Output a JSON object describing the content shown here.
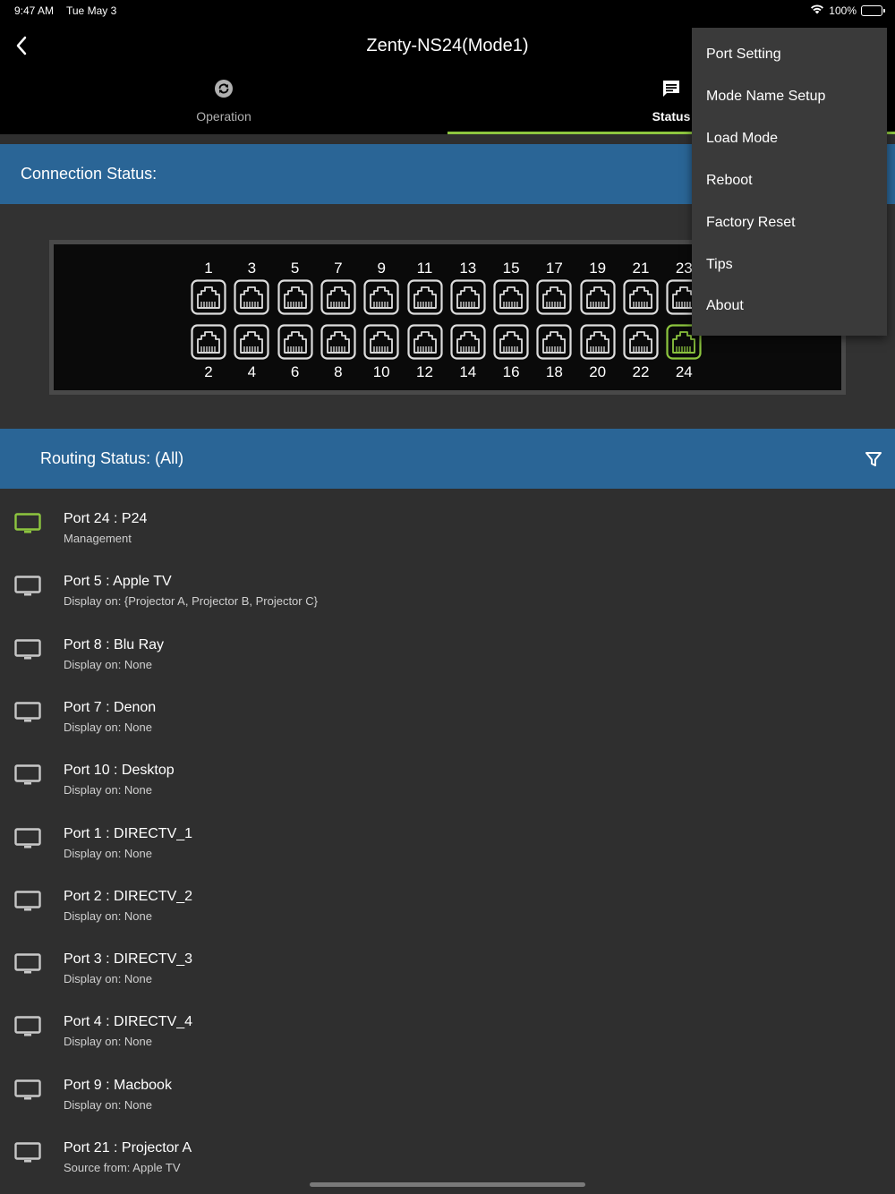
{
  "status_bar": {
    "time": "9:47 AM",
    "date": "Tue May 3",
    "battery": "100%"
  },
  "nav": {
    "title": "Zenty-NS24(Mode1)"
  },
  "tabs": [
    {
      "label": "Operation",
      "icon": "sync-icon",
      "active": false
    },
    {
      "label": "Status",
      "icon": "message-icon",
      "active": true
    }
  ],
  "connection_status": {
    "label": "Connection Status:"
  },
  "ports": {
    "top": [
      "1",
      "3",
      "5",
      "7",
      "9",
      "11",
      "13",
      "15",
      "17",
      "19",
      "21",
      "23"
    ],
    "bottom": [
      "2",
      "4",
      "6",
      "8",
      "10",
      "12",
      "14",
      "16",
      "18",
      "20",
      "22",
      "24"
    ],
    "active_port": "24"
  },
  "routing_status": {
    "label": "Routing Status: (All)"
  },
  "routes": [
    {
      "title": "Port 24 : P24",
      "subtitle": "Management",
      "active": true
    },
    {
      "title": "Port 5 : Apple TV",
      "subtitle": "Display on: {Projector A, Projector B, Projector C}",
      "active": false
    },
    {
      "title": "Port 8 : Blu Ray",
      "subtitle": "Display on: None",
      "active": false
    },
    {
      "title": "Port 7 : Denon",
      "subtitle": "Display on: None",
      "active": false
    },
    {
      "title": "Port 10 : Desktop",
      "subtitle": "Display on: None",
      "active": false
    },
    {
      "title": "Port 1 : DIRECTV_1",
      "subtitle": "Display on: None",
      "active": false
    },
    {
      "title": "Port 2 : DIRECTV_2",
      "subtitle": "Display on: None",
      "active": false
    },
    {
      "title": "Port 3 : DIRECTV_3",
      "subtitle": "Display on: None",
      "active": false
    },
    {
      "title": "Port 4 : DIRECTV_4",
      "subtitle": "Display on: None",
      "active": false
    },
    {
      "title": "Port 9 : Macbook",
      "subtitle": "Display on: None",
      "active": false
    },
    {
      "title": "Port 21 : Projector A",
      "subtitle": "Source from: Apple TV",
      "active": false
    }
  ],
  "menu": {
    "items": [
      "Port Setting",
      "Mode Name Setup",
      "Load Mode",
      "Reboot",
      "Factory Reset",
      "Tips",
      "About"
    ]
  },
  "colors": {
    "accent_green": "#8dc63f",
    "header_blue": "#2a6596",
    "background": "#2f2f2f",
    "port_outline": "#dddddd"
  }
}
